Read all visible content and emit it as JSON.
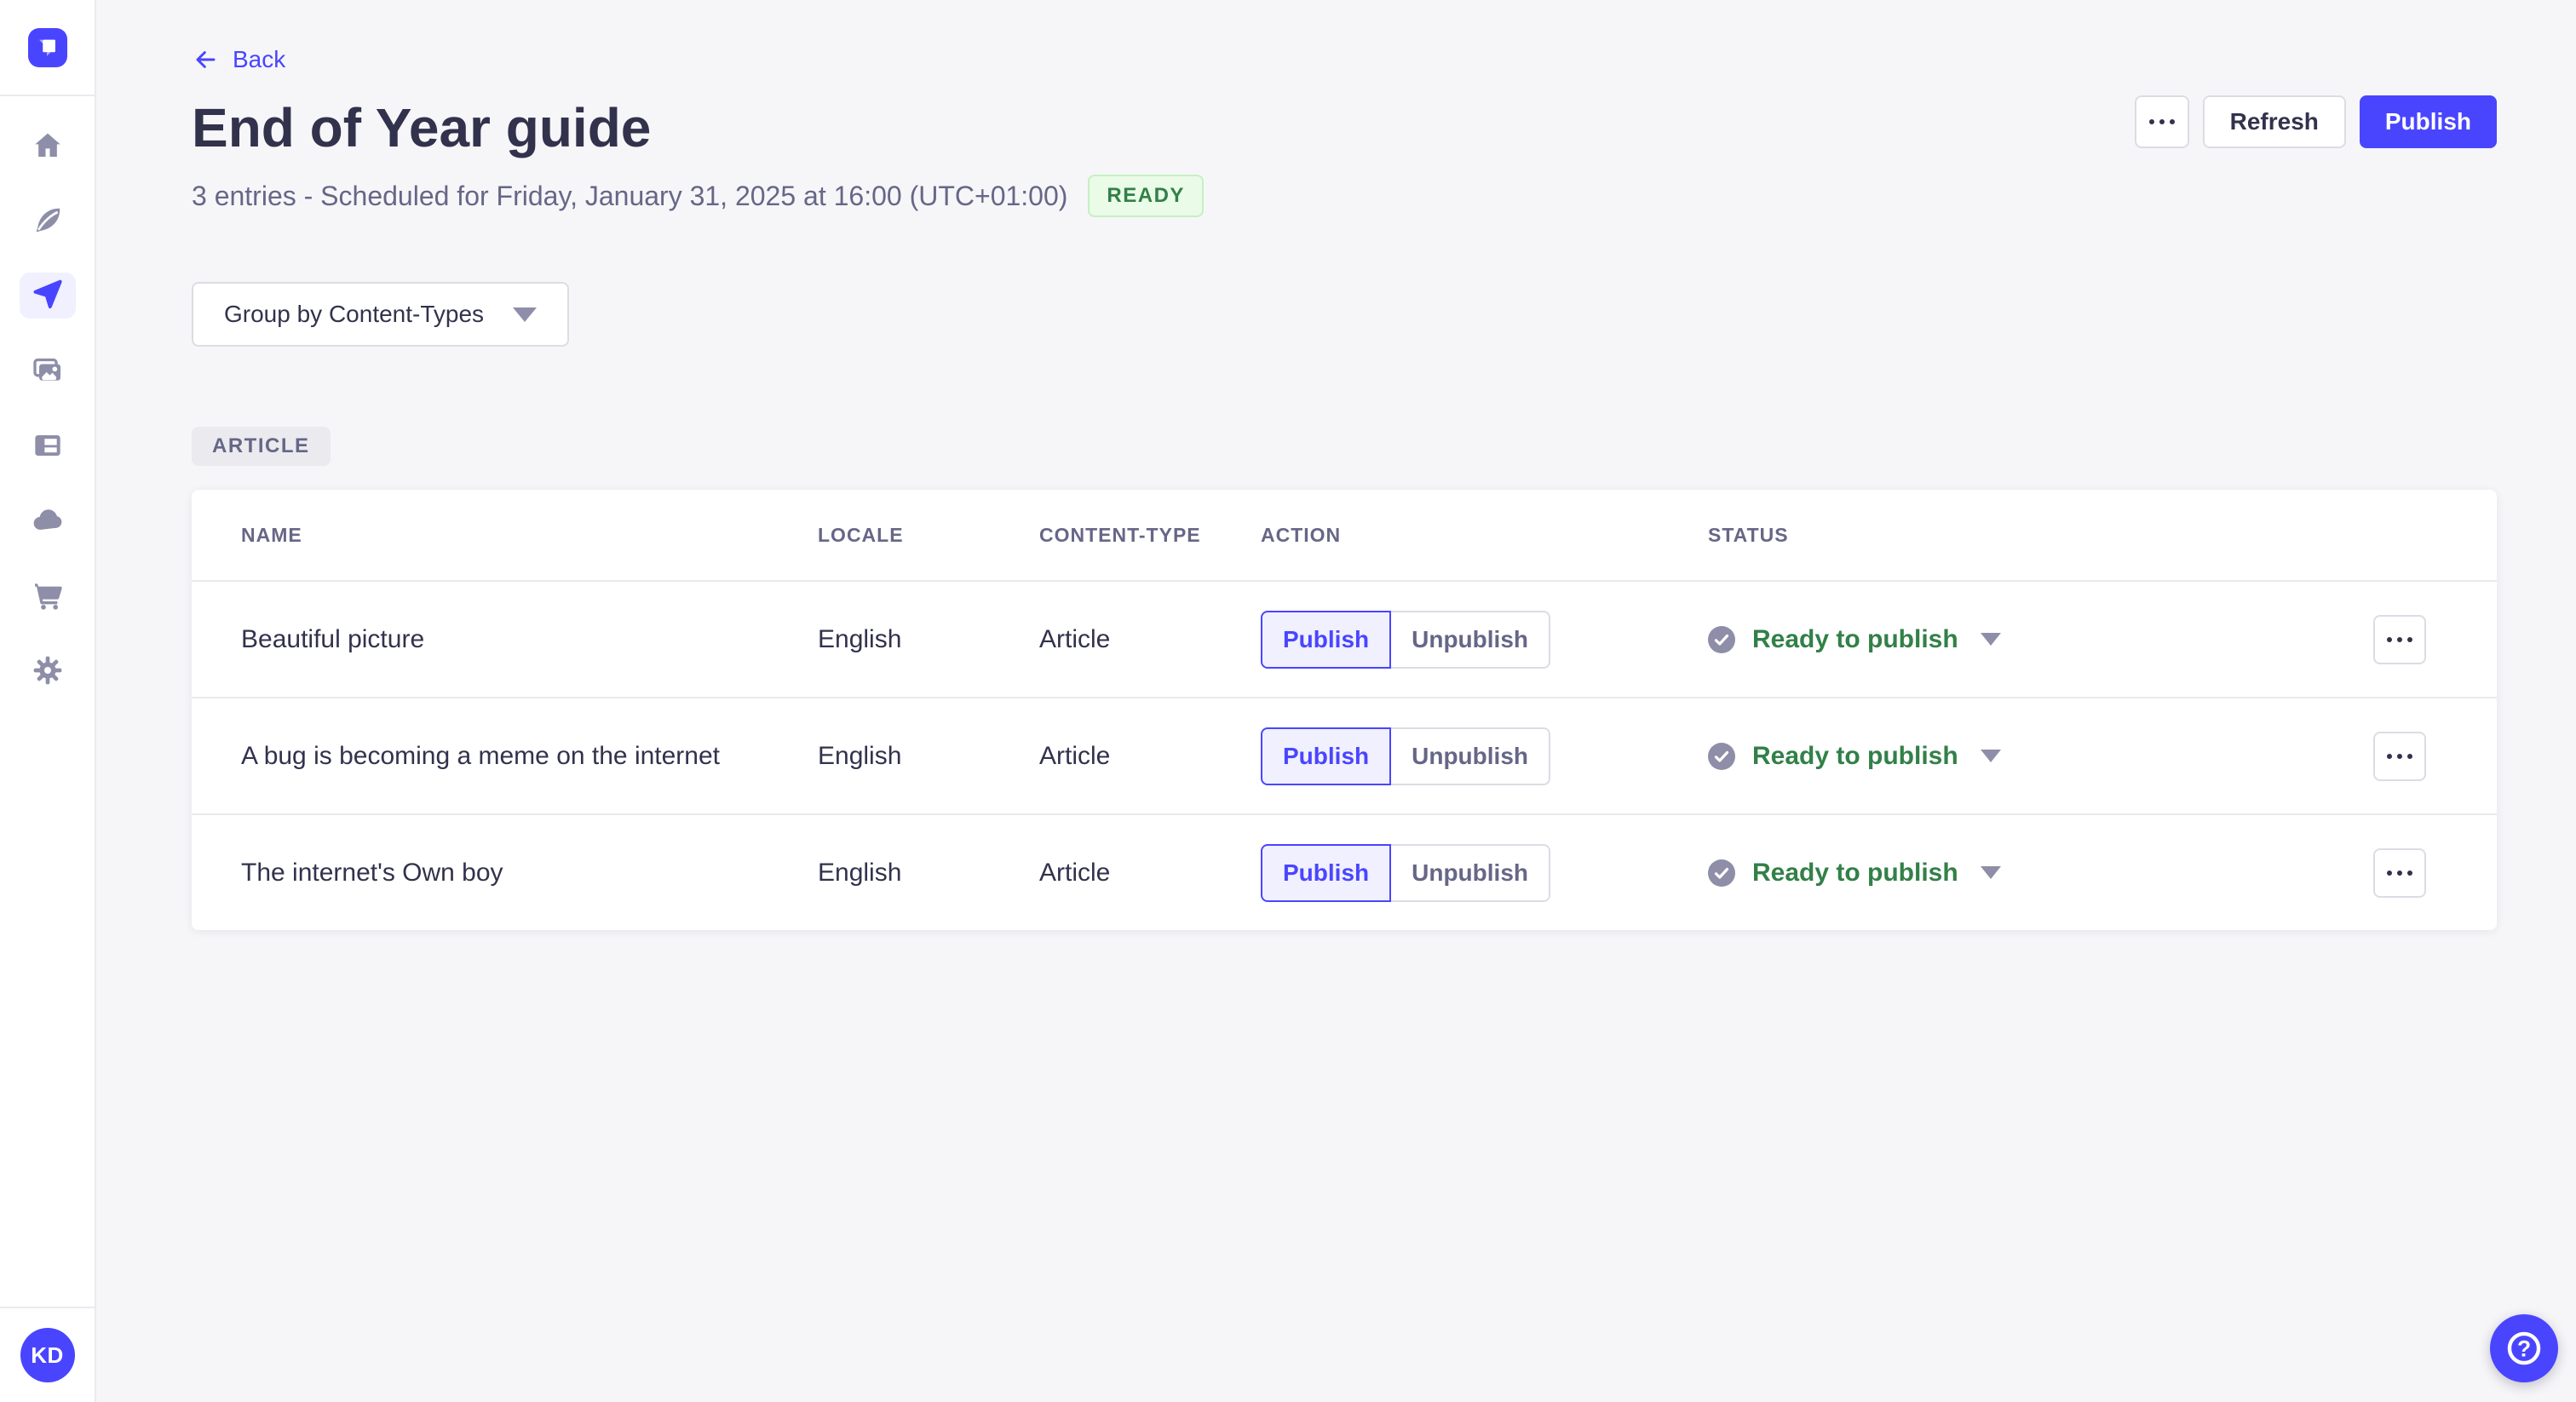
{
  "colors": {
    "accent": "#4945ff",
    "accent_light_bg": "#f0f0ff",
    "page_bg": "#f6f6f9",
    "success_text": "#328048",
    "success_bg": "#eafbe7",
    "success_border": "#c6f0c2",
    "text_primary": "#32324d",
    "text_secondary": "#666687",
    "border": "#dcdce4",
    "divider": "#eaeaef",
    "icon_gray": "#8e8ea9"
  },
  "sidebar": {
    "logo_icon": "strapi-logo",
    "user_initials": "KD",
    "items": [
      {
        "id": "home",
        "icon": "home-icon",
        "active": false
      },
      {
        "id": "content-manager",
        "icon": "feather-icon",
        "active": false
      },
      {
        "id": "releases",
        "icon": "paper-plane-icon",
        "active": true
      },
      {
        "id": "media-library",
        "icon": "pictures-icon",
        "active": false
      },
      {
        "id": "content-type-builder",
        "icon": "layout-icon",
        "active": false
      },
      {
        "id": "cloud",
        "icon": "cloud-icon",
        "active": false
      },
      {
        "id": "marketplace",
        "icon": "cart-icon",
        "active": false
      },
      {
        "id": "settings",
        "icon": "gear-icon",
        "active": false
      }
    ]
  },
  "header": {
    "back_label": "Back",
    "title": "End of Year guide",
    "subtitle": "3 entries - Scheduled for Friday, January 31, 2025 at 16:00 (UTC+01:00)",
    "status_badge": "READY",
    "more_icon": "ellipsis-icon",
    "refresh_label": "Refresh",
    "publish_label": "Publish"
  },
  "filters": {
    "group_by": "Group by Content-Types",
    "caret_icon": "chevron-down-icon"
  },
  "group": {
    "label": "ARTICLE"
  },
  "table": {
    "columns": [
      "NAME",
      "LOCALE",
      "CONTENT-TYPE",
      "ACTION",
      "STATUS"
    ],
    "action_publish": "Publish",
    "action_unpublish": "Unpublish",
    "status_icon": "check-circle-icon",
    "row_more_icon": "ellipsis-icon",
    "rows": [
      {
        "name": "Beautiful picture",
        "locale": "English",
        "content_type": "Article",
        "status": "Ready to publish"
      },
      {
        "name": "A bug is becoming a meme on the internet",
        "locale": "English",
        "content_type": "Article",
        "status": "Ready to publish"
      },
      {
        "name": "The internet's Own boy",
        "locale": "English",
        "content_type": "Article",
        "status": "Ready to publish"
      }
    ]
  },
  "fab": {
    "icon": "question-circle-icon",
    "glyph": "?"
  }
}
